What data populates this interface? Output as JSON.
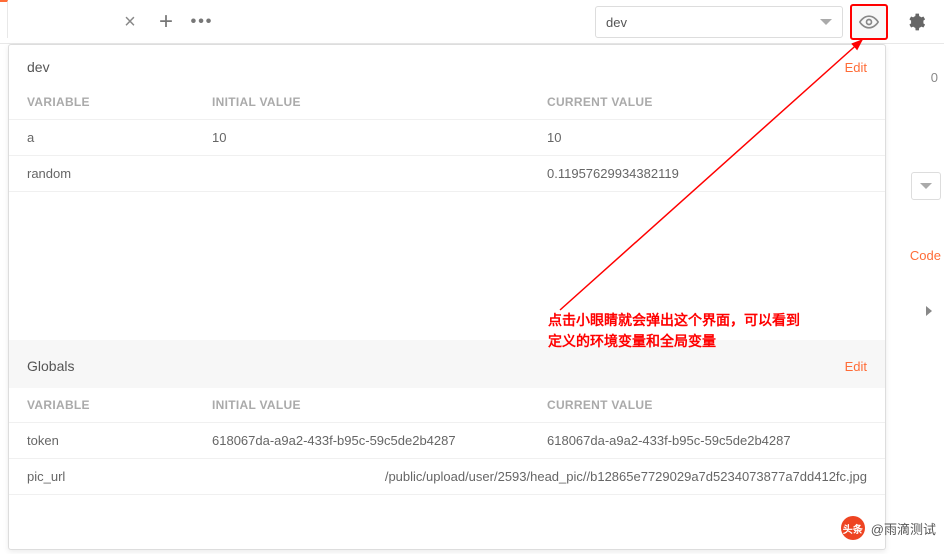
{
  "topbar": {
    "env_selected": "dev"
  },
  "sections": {
    "dev": {
      "title": "dev",
      "edit_label": "Edit",
      "headers": {
        "variable": "VARIABLE",
        "initial": "INITIAL VALUE",
        "current": "CURRENT VALUE"
      },
      "rows": [
        {
          "variable": "a",
          "initial": "10",
          "current": "10"
        },
        {
          "variable": "random",
          "initial": "",
          "current": "0.11957629934382119"
        }
      ]
    },
    "globals": {
      "title": "Globals",
      "edit_label": "Edit",
      "headers": {
        "variable": "VARIABLE",
        "initial": "INITIAL VALUE",
        "current": "CURRENT VALUE"
      },
      "rows": [
        {
          "variable": "token",
          "initial": "618067da-a9a2-433f-b95c-59c5de2b4287",
          "current": "618067da-a9a2-433f-b95c-59c5de2b4287"
        },
        {
          "variable": "pic_url",
          "initial": "",
          "current": "/public/upload/user/2593/head_pic//b12865e7729029a7d5234073877a7dd412fc.jpg"
        }
      ]
    }
  },
  "annotation": {
    "line1": "点击小眼睛就会弹出这个界面，可以看到",
    "line2": "定义的环境变量和全局变量"
  },
  "behind": {
    "code": "Code",
    "zero": "0"
  },
  "watermark": {
    "badge": "头条",
    "text": "@雨滴测试"
  }
}
